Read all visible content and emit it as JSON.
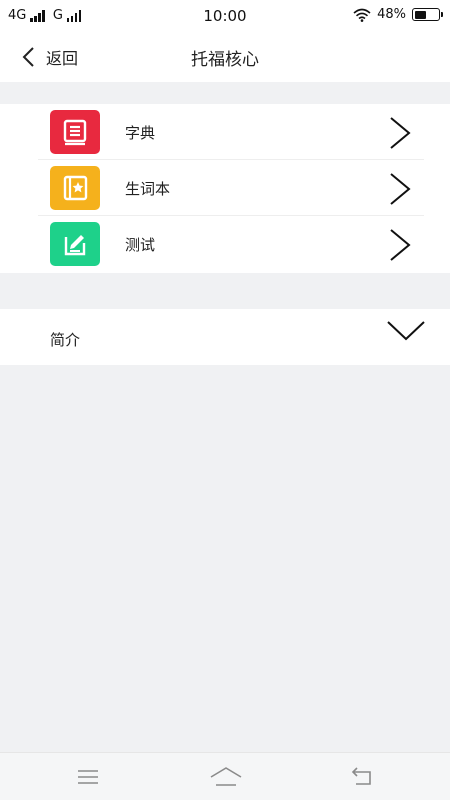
{
  "status_bar": {
    "network_1": "4G",
    "network_2": "G",
    "time": "10:00",
    "battery_percent": "48%",
    "battery_level": 0.48,
    "icons": [
      "signal-icon",
      "wifi-icon",
      "battery-icon"
    ]
  },
  "nav": {
    "back_label": "返回",
    "title": "托福核心",
    "back_icon": "chevron-left-icon"
  },
  "menu": {
    "items": [
      {
        "label": "字典",
        "icon": "dictionary-book-icon",
        "color": "#e8293f"
      },
      {
        "label": "生词本",
        "icon": "star-notebook-icon",
        "color": "#f5b11c"
      },
      {
        "label": "测试",
        "icon": "pencil-test-icon",
        "color": "#1ed18a"
      }
    ]
  },
  "intro": {
    "label": "简介",
    "icon": "chevron-down-icon"
  },
  "system_nav": {
    "icons": [
      "menu-icon",
      "home-icon",
      "back-icon"
    ]
  }
}
